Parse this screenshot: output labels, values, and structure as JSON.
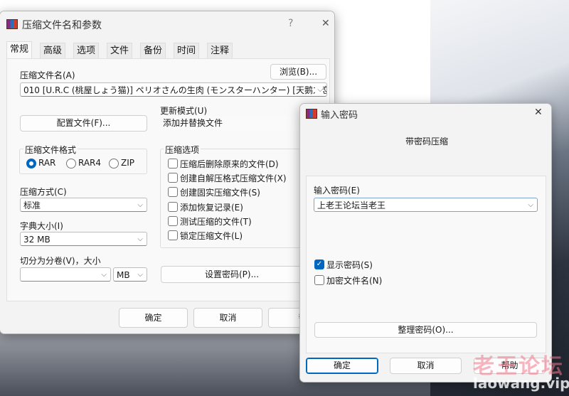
{
  "main_dialog": {
    "title": "压缩文件名和参数",
    "help": "?",
    "close": "✕",
    "tabs": [
      "常规",
      "高级",
      "选项",
      "文件",
      "备份",
      "时间",
      "注释"
    ],
    "archive_name_label": "压缩文件名(A)",
    "browse_button": "浏览(B)...",
    "archive_name_value": "010   [U.R.C (桃屋しょう猫)] ペリオさんの生肉 (モンスターハンター) [天鹅之恋",
    "profiles_button": "配置文件(F)...",
    "update_mode_label": "更新模式(U)",
    "update_mode_value": "添加并替换文件",
    "format_group": "压缩文件格式",
    "formats": [
      "RAR",
      "RAR4",
      "ZIP"
    ],
    "selected_format": "RAR",
    "method_label": "压缩方式(C)",
    "method_value": "标准",
    "dict_label": "字典大小(I)",
    "dict_value": "32 MB",
    "split_label": "切分为分卷(V)，大小",
    "split_value": "",
    "split_unit": "MB",
    "options_group": "压缩选项",
    "options": [
      {
        "label": "压缩后删除原来的文件(D)",
        "checked": false
      },
      {
        "label": "创建自解压格式压缩文件(X)",
        "checked": false
      },
      {
        "label": "创建固实压缩文件(S)",
        "checked": false
      },
      {
        "label": "添加恢复记录(E)",
        "checked": false
      },
      {
        "label": "测试压缩的文件(T)",
        "checked": false
      },
      {
        "label": "锁定压缩文件(L)",
        "checked": false
      }
    ],
    "set_password_button": "设置密码(P)...",
    "ok": "确定",
    "cancel": "取消",
    "help_button": "帮"
  },
  "password_dialog": {
    "title": "输入密码",
    "close": "✕",
    "heading": "带密码压缩",
    "password_label": "输入密码(E)",
    "password_value": "上老王论坛当老王",
    "show_password": {
      "label": "显示密码(S)",
      "checked": true
    },
    "encrypt_names": {
      "label": "加密文件名(N)",
      "checked": false
    },
    "organize_button": "整理密码(O)...",
    "ok": "确定",
    "cancel": "取消",
    "help": "帮助"
  },
  "watermark": {
    "line1": "老王论坛",
    "line2": "laowang.vip"
  },
  "colors": {
    "accent": "#0067c0"
  }
}
